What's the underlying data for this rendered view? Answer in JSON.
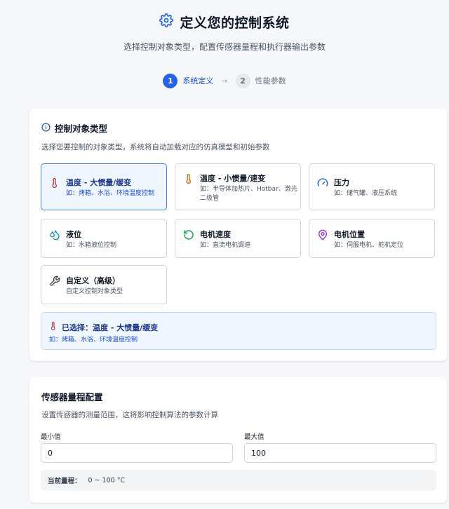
{
  "header": {
    "title": "定义您的控制系统",
    "subtitle": "选择控制对象类型，配置传感器量程和执行器输出参数"
  },
  "steps": [
    {
      "num": "1",
      "label": "系统定义"
    },
    {
      "num": "2",
      "label": "性能参数"
    }
  ],
  "colors": {
    "accent": "#2563eb",
    "selected_bg": "#eff6ff"
  },
  "plant": {
    "title": "控制对象类型",
    "description": "选择您要控制的对象类型，系统将自动加载对应的仿真模型和初始参数",
    "options": [
      {
        "name": "温度 - 大惯量/缓变",
        "desc": "如：烤箱、水浴、环境温度控制",
        "icon": "thermometer-icon"
      },
      {
        "name": "温度 - 小惯量/速变",
        "desc": "如：半导体加热片、Hotbar、激光二极管",
        "icon": "thermometer-icon"
      },
      {
        "name": "压力",
        "desc": "如：储气罐、液压系统",
        "icon": "gauge-icon"
      },
      {
        "name": "液位",
        "desc": "如：水箱液位控制",
        "icon": "droplets-icon"
      },
      {
        "name": "电机速度",
        "desc": "如：直流电机调速",
        "icon": "rotate-icon"
      },
      {
        "name": "电机位置",
        "desc": "如：伺服电机、舵机定位",
        "icon": "map-pin-icon"
      },
      {
        "name": "自定义（高级）",
        "desc": "自定义控制对象类型",
        "icon": "wrench-icon"
      }
    ],
    "selected_index": 0,
    "selected_label": "已选择：温度 - 大惯量/缓变",
    "selected_desc": "如：烤箱、水浴、环境温度控制"
  },
  "sensor": {
    "title": "传感器量程配置",
    "description": "设置传感器的测量范围，这将影响控制算法的参数计算",
    "min_label": "最小值",
    "min_value": "0",
    "max_label": "最大值",
    "max_value": "100",
    "range_label": "当前量程：",
    "range_value": "0 ~ 100 °C"
  }
}
